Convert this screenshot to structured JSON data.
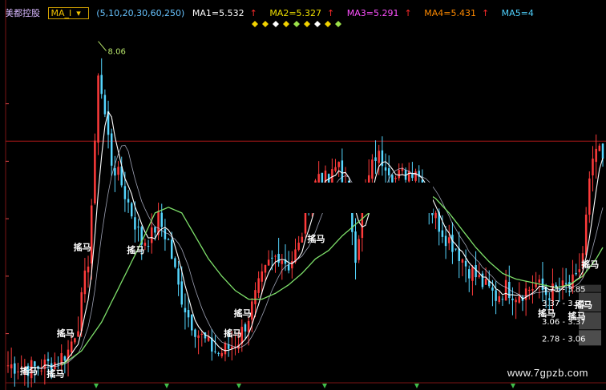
{
  "header": {
    "stock_name": "美都控股",
    "indicator_selector": "MA_I",
    "params": "(5,10,20,30,60,250)",
    "ma1": "MA1=5.532",
    "ma2": "MA2=5.327",
    "ma3": "MA3=5.291",
    "ma4": "MA4=5.431",
    "ma5": "MA5=4"
  },
  "watermark": "www.7gpzb.com",
  "colors": {
    "background": "#000000",
    "up_candle": "#ff3b3b",
    "down_candle": "#55d6ff",
    "ma_white": "#ffffff",
    "ma_green": "#7ee06a",
    "reference_line": "#b01818",
    "axis_text": "#e24848",
    "range_box": "#5a5a5a"
  },
  "chart_data": {
    "type": "candlestick",
    "title": "",
    "xlabel": "",
    "ylabel": "",
    "ylim": [
      2.2,
      8.5
    ],
    "grid": false,
    "reference_line": 6.35,
    "peak_annotation": {
      "index": 27,
      "label": "8.06"
    },
    "close_path": [
      [
        0,
        2.45
      ],
      [
        8,
        2.4
      ],
      [
        14,
        2.5
      ],
      [
        18,
        2.7
      ],
      [
        21,
        3.2
      ],
      [
        24,
        4.3
      ],
      [
        26,
        6.2
      ],
      [
        27,
        7.6
      ],
      [
        29,
        6.8
      ],
      [
        31,
        6.0
      ],
      [
        34,
        5.6
      ],
      [
        37,
        5.1
      ],
      [
        40,
        4.6
      ],
      [
        43,
        4.7
      ],
      [
        45,
        5.0
      ],
      [
        48,
        4.6
      ],
      [
        51,
        3.8
      ],
      [
        54,
        3.3
      ],
      [
        57,
        3.0
      ],
      [
        60,
        2.8
      ],
      [
        63,
        2.65
      ],
      [
        66,
        2.75
      ],
      [
        69,
        2.9
      ],
      [
        72,
        3.3
      ],
      [
        75,
        3.8
      ],
      [
        78,
        4.2
      ],
      [
        81,
        4.4
      ],
      [
        84,
        4.2
      ],
      [
        87,
        4.5
      ],
      [
        90,
        5.3
      ],
      [
        93,
        5.8
      ],
      [
        96,
        5.6
      ],
      [
        99,
        6.0
      ],
      [
        102,
        5.3
      ],
      [
        104,
        4.4
      ],
      [
        107,
        5.5
      ],
      [
        110,
        6.1
      ],
      [
        113,
        6.0
      ],
      [
        116,
        5.7
      ],
      [
        119,
        5.8
      ],
      [
        122,
        5.9
      ],
      [
        125,
        5.4
      ],
      [
        128,
        5.0
      ],
      [
        131,
        4.7
      ],
      [
        134,
        4.5
      ],
      [
        137,
        4.2
      ],
      [
        140,
        4.0
      ],
      [
        143,
        3.8
      ],
      [
        146,
        3.65
      ],
      [
        149,
        3.8
      ],
      [
        152,
        3.7
      ],
      [
        155,
        3.75
      ],
      [
        158,
        3.85
      ],
      [
        161,
        3.7
      ],
      [
        164,
        3.75
      ],
      [
        167,
        3.8
      ],
      [
        170,
        3.9
      ],
      [
        172,
        4.4
      ],
      [
        174,
        5.6
      ],
      [
        176,
        6.2
      ],
      [
        178,
        6.0
      ]
    ],
    "ma_long_path": [
      [
        16,
        2.45
      ],
      [
        22,
        2.7
      ],
      [
        28,
        3.2
      ],
      [
        34,
        3.9
      ],
      [
        40,
        4.6
      ],
      [
        44,
        5.1
      ],
      [
        48,
        5.2
      ],
      [
        52,
        5.1
      ],
      [
        56,
        4.7
      ],
      [
        60,
        4.3
      ],
      [
        64,
        4.0
      ],
      [
        68,
        3.75
      ],
      [
        72,
        3.6
      ],
      [
        76,
        3.6
      ],
      [
        80,
        3.7
      ],
      [
        84,
        3.85
      ],
      [
        88,
        4.05
      ],
      [
        92,
        4.3
      ],
      [
        96,
        4.45
      ],
      [
        100,
        4.7
      ],
      [
        104,
        4.9
      ],
      [
        108,
        5.1
      ],
      [
        112,
        5.25
      ],
      [
        116,
        5.35
      ],
      [
        120,
        5.45
      ],
      [
        124,
        5.5
      ],
      [
        128,
        5.35
      ],
      [
        132,
        5.1
      ],
      [
        136,
        4.8
      ],
      [
        140,
        4.5
      ],
      [
        144,
        4.25
      ],
      [
        148,
        4.05
      ],
      [
        152,
        3.95
      ],
      [
        156,
        3.9
      ],
      [
        160,
        3.85
      ],
      [
        164,
        3.8
      ],
      [
        168,
        3.85
      ],
      [
        172,
        4.0
      ],
      [
        176,
        4.3
      ],
      [
        178,
        4.5
      ]
    ],
    "trade_marks": [
      {
        "label": "搖马",
        "index": 6,
        "price": 2.3
      },
      {
        "label": "搖马",
        "index": 14,
        "price": 2.25
      },
      {
        "label": "搖马",
        "index": 17,
        "price": 2.95
      },
      {
        "label": "搖马",
        "index": 22,
        "price": 4.45
      },
      {
        "label": "搖马",
        "index": 38,
        "price": 4.4
      },
      {
        "label": "搖马",
        "index": 67,
        "price": 2.95
      },
      {
        "label": "搖马",
        "index": 70,
        "price": 3.3
      },
      {
        "label": "搖马",
        "index": 92,
        "price": 4.6
      },
      {
        "label": "搖马",
        "index": 161,
        "price": 3.3
      },
      {
        "label": "搖马",
        "index": 170,
        "price": 3.25
      },
      {
        "label": "搖马",
        "index": 172,
        "price": 3.45
      },
      {
        "label": "搖马",
        "index": 174,
        "price": 4.15
      }
    ],
    "price_ranges": [
      {
        "label": "3.71 - 3.85",
        "low": 3.71,
        "high": 3.85
      },
      {
        "label": "3.37 - 3.71",
        "low": 3.37,
        "high": 3.71
      },
      {
        "label": "3.06 - 3.37",
        "low": 3.06,
        "high": 3.37
      },
      {
        "label": "2.78 - 3.06",
        "low": 2.78,
        "high": 3.06
      }
    ]
  }
}
